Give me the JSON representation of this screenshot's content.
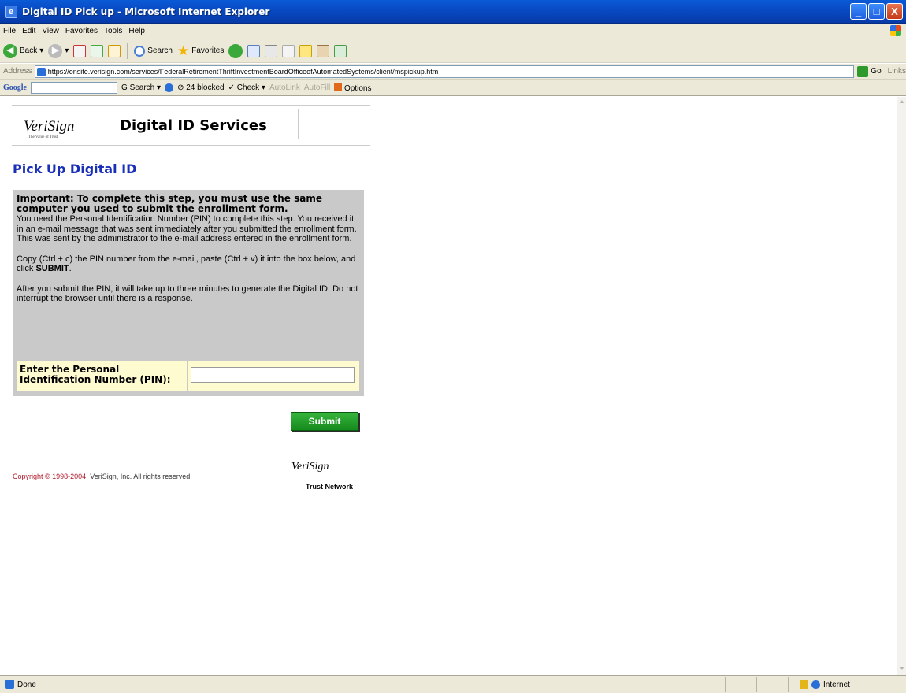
{
  "window": {
    "title": "Digital ID Pick up - Microsoft Internet Explorer",
    "controls": [
      "_",
      "□",
      "X"
    ]
  },
  "menu": [
    "File",
    "Edit",
    "View",
    "Favorites",
    "Tools",
    "Help"
  ],
  "toolbar": {
    "back": "Back",
    "search": "Search",
    "favorites": "Favorites"
  },
  "address": {
    "label": "Address",
    "url": "https://onsite.verisign.com/services/FederalRetirementThriftInvestmentBoardOfficeofAutomatedSystems/client/mspickup.htm",
    "go": "Go",
    "links": "Links"
  },
  "google_toolbar": {
    "logo": "Google",
    "search": "Search",
    "blocked": "24 blocked",
    "check": "Check",
    "autolink": "AutoLink",
    "autofill": "AutoFill",
    "options": "Options"
  },
  "page": {
    "brand": "VeriSign",
    "brand_tagline": "The Value of Trust",
    "service_title": "Digital ID Services",
    "heading": "Pick Up Digital ID",
    "important": "Important: To complete this step, you must use the same computer you used to submit the enrollment form.",
    "para1": "You need the Personal Identification Number (PIN) to complete this step. You received it in an e-mail message that was sent immediately after you submitted the enrollment form.",
    "para2": "This was sent by the administrator to the e-mail address entered in the enrollment form.",
    "para3_a": "Copy (Ctrl + c) the PIN number from the e-mail, paste (Ctrl + v) it into the box below, and click ",
    "para3_b": "SUBMIT",
    "para3_c": ".",
    "para4": "After you submit the PIN, it will take up to three minutes to generate the Digital ID. Do not interrupt the browser until there is a response.",
    "pin_label": "Enter the Personal Identification Number (PIN):",
    "pin_value": "",
    "submit": "Submit",
    "copyright_link": "Copyright © 1998-2004",
    "copyright_rest": ", VeriSign, Inc. All rights reserved.",
    "footer_brand": "VeriSign",
    "footer_network": "Trust Network"
  },
  "status": {
    "text": "Done",
    "zone": "Internet"
  }
}
